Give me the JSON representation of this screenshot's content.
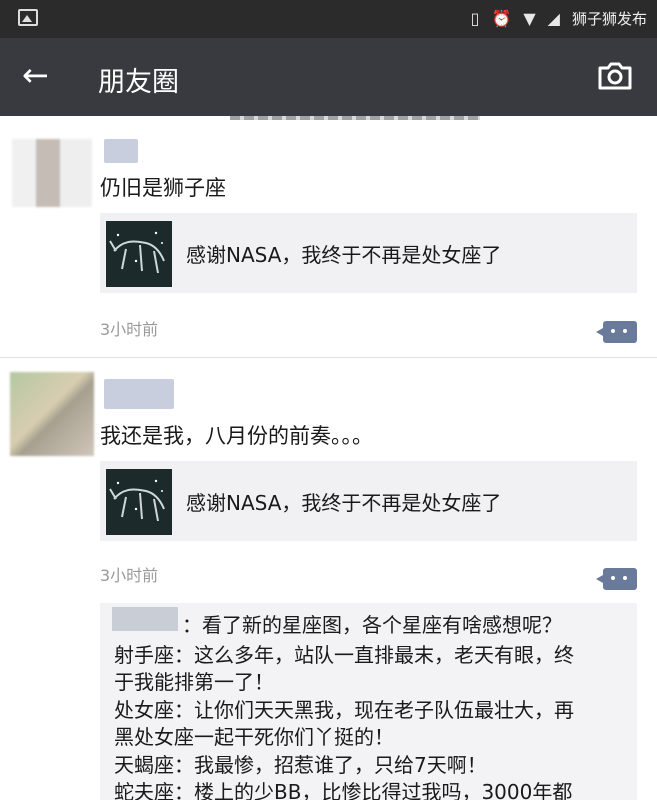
{
  "status_bar": {
    "time": "狮子狮发布",
    "icons": [
      "image-notification-icon",
      "vibrate-icon",
      "alarm-icon",
      "wifi-icon",
      "signal-icon"
    ]
  },
  "titlebar": {
    "title": "朋友圈",
    "back_icon": "back-arrow-icon",
    "camera_icon": "camera-icon"
  },
  "posts": [
    {
      "text": "仍旧是狮子座",
      "share_text": "感谢NASA，我终于不再是处女座了",
      "time": "3小时前"
    },
    {
      "text": "我还是我，八月份的前奏。。。",
      "share_text": "感谢NASA，我终于不再是处女座了",
      "time": "3小时前"
    }
  ],
  "comments": [
    "：看了新的星座图，各个星座有啥感想呢？",
    "射手座：这么多年，站队一直排最末，老天有眼，终",
    "于我能排第一了！",
    "处女座：让你们天天黑我，现在老子队伍最壮大，再",
    "黑处女座一起干死你们丫挺的！",
    "天蝎座：我最惨，招惹谁了，只给7天啊！",
    "蛇夫座：楼上的少BB，比惨比得过我吗，3000年都"
  ],
  "colors": {
    "titlebar": "#393a3f",
    "statusbar": "#2b2b2b",
    "share_card": "#f1f1f3",
    "time_text": "#9a9a9a",
    "comment_button": "#6a7a9a"
  }
}
